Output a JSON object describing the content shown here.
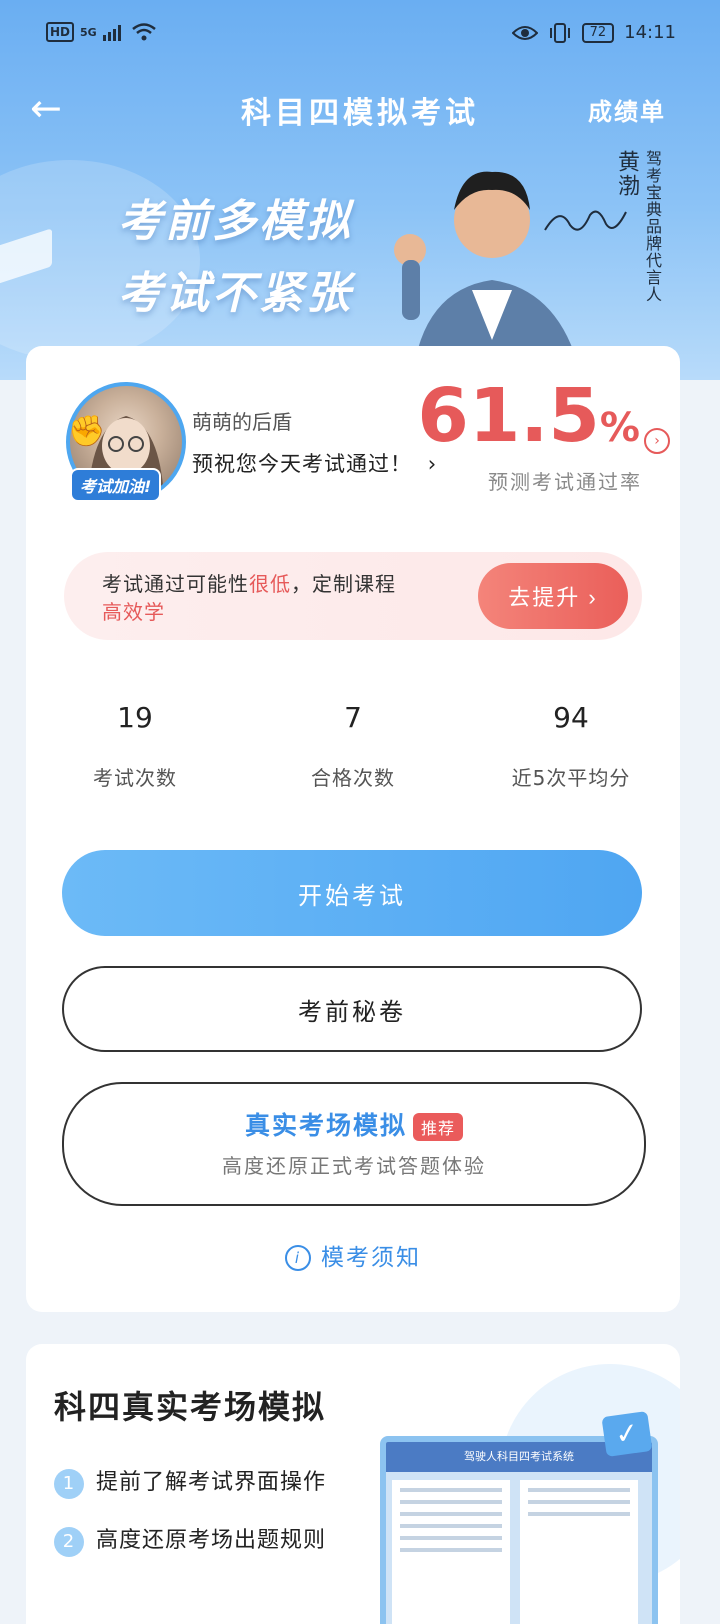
{
  "status_bar": {
    "hd": "HD",
    "network": "5G",
    "battery": "72",
    "time": "14:11"
  },
  "nav": {
    "title": "科目四模拟考试",
    "right_label": "成绩单"
  },
  "hero": {
    "slogan_line1": "考前多模拟",
    "slogan_line2": "考试不紧张",
    "spokesperson_name": "黄渤",
    "spokesperson_role": "驾考宝典品牌代言人"
  },
  "profile": {
    "avatar_badge": "考试加油!",
    "username": "萌萌的后盾",
    "wish": "预祝您今天考试通过！",
    "pass_rate": "61.5",
    "pass_rate_unit": "%",
    "pass_rate_label": "预测考试通过率"
  },
  "tip": {
    "text_prefix": "考试通过可能性",
    "text_emphasis": "很低",
    "text_suffix": "，定制课程",
    "text_line2": "高效学",
    "button_label": "去提升"
  },
  "stats": [
    {
      "value": "19",
      "label": "考试次数"
    },
    {
      "value": "7",
      "label": "合格次数"
    },
    {
      "value": "94",
      "label": "近5次平均分"
    }
  ],
  "buttons": {
    "start": "开始考试",
    "secret": "考前秘卷",
    "real_title": "真实考场模拟",
    "real_tag": "推荐",
    "real_subtitle": "高度还原正式考试答题体验",
    "notice": "模考须知"
  },
  "section2": {
    "title": "科四真实考场模拟",
    "items": [
      {
        "num": "1",
        "text": "提前了解考试界面操作"
      },
      {
        "num": "2",
        "text": "高度还原考场出题规则"
      }
    ],
    "preview_title": "驾驶人科目四考试系统"
  },
  "colors": {
    "accent_blue": "#4fa6f2",
    "danger_red": "#e65a5a"
  }
}
